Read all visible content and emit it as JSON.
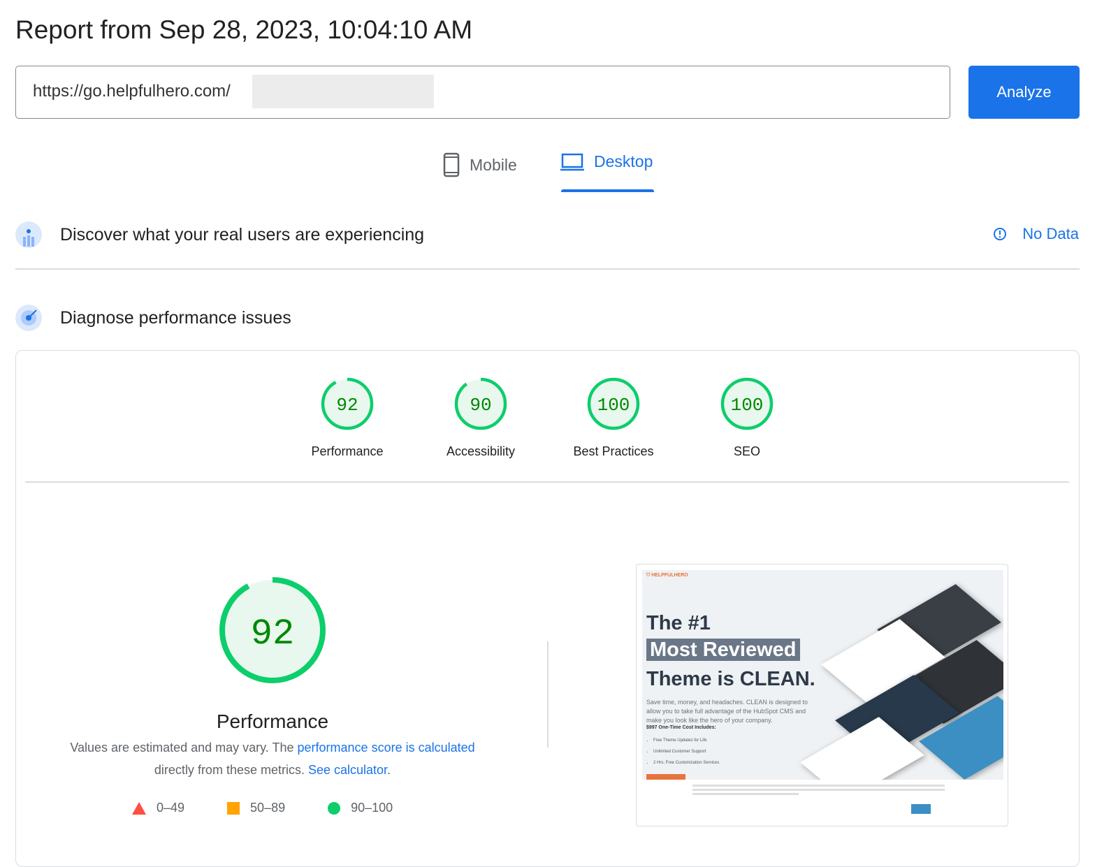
{
  "title": "Report from Sep 28, 2023, 10:04:10 AM",
  "url_input": {
    "value": "https://go.helpfulhero.com/"
  },
  "analyze_label": "Analyze",
  "tabs": [
    {
      "label": "Mobile",
      "icon": "phone-icon",
      "active": false
    },
    {
      "label": "Desktop",
      "icon": "laptop-icon",
      "active": true
    }
  ],
  "field_data": {
    "heading": "Discover what your real users are experiencing",
    "status": "No Data",
    "status_icon": "info-icon"
  },
  "lab_data": {
    "heading": "Diagnose performance issues"
  },
  "scores": [
    {
      "label": "Performance",
      "value": 92
    },
    {
      "label": "Accessibility",
      "value": 90
    },
    {
      "label": "Best Practices",
      "value": 100
    },
    {
      "label": "SEO",
      "value": 100
    }
  ],
  "colors": {
    "accent": "#1a73e8",
    "pass": "#0cce6b",
    "pass_text": "#008800",
    "average": "#ffa400",
    "fail": "#ff4e42"
  },
  "performance": {
    "score": 92,
    "title": "Performance",
    "desc_pre": "Values are estimated and may vary. The ",
    "desc_link1": "performance score is calculated",
    "desc_mid": " directly from these metrics. ",
    "desc_link2": "See calculator."
  },
  "legend": [
    {
      "range": "0–49",
      "shape": "triangle"
    },
    {
      "range": "50–89",
      "shape": "square"
    },
    {
      "range": "90–100",
      "shape": "circle"
    }
  ],
  "screenshot": {
    "headline1": "The #1",
    "headline2": "Most Reviewed",
    "headline3": "Theme is CLEAN.",
    "paragraph": "Save time, money, and headaches. CLEAN is designed to allow you to take full advantage of the HubSpot CMS and make you look like the hero of your company.",
    "cost": "$997 One-Time Cost Includes:",
    "bullets": [
      "Free Theme Updates for Life",
      "Unlimited Customer Support",
      "2 Hrs. Free Customization Services"
    ]
  }
}
